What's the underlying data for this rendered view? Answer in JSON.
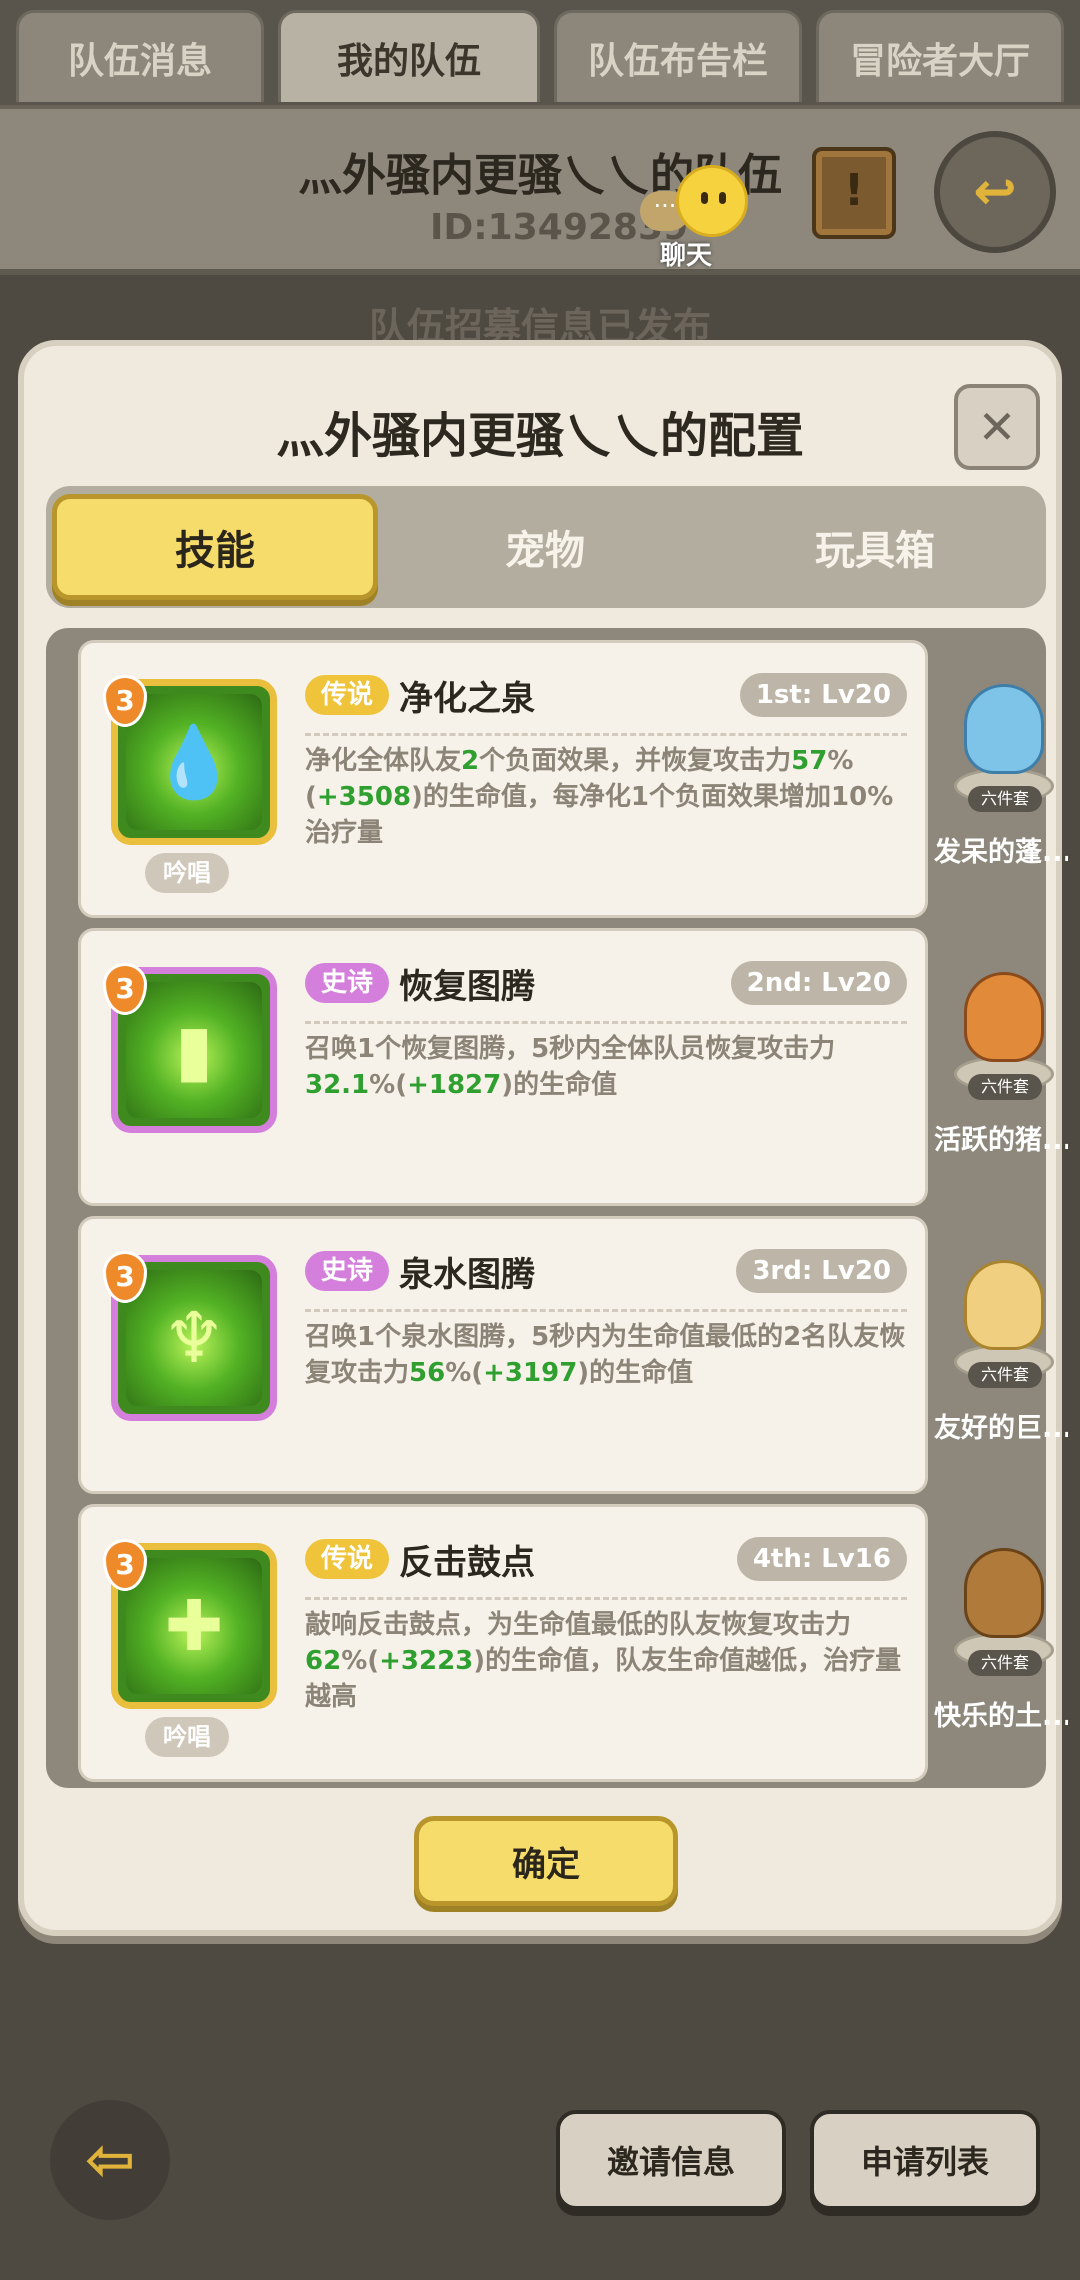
{
  "top_tabs": [
    "队伍消息",
    "我的队伍",
    "队伍布告栏",
    "冒险者大厅"
  ],
  "team": {
    "name": "灬外骚内更骚乀乀的队伍",
    "id_text": "ID:13492839",
    "chat_label": "聊天",
    "recruit_message": "队伍招募信息已发布"
  },
  "modal": {
    "title": "灬外骚内更骚乀乀的配置",
    "close_glyph": "✕",
    "tabs": [
      "技能",
      "宠物",
      "玩具箱"
    ],
    "confirm_label": "确定"
  },
  "skills": [
    {
      "level": "3",
      "rarity": "传说",
      "name": "净化之泉",
      "slot": "1st: Lv20",
      "chant": "吟唱",
      "desc_parts": [
        "净化全体队友",
        "2",
        "个负面效果，并恢复攻击力",
        "57",
        "%(",
        "+3508",
        ")的生命值，每净化1个负面效果增加10%治疗量"
      ],
      "pet_tag": "六件套",
      "pet_name": "发呆的蓬..."
    },
    {
      "level": "3",
      "rarity": "史诗",
      "name": "恢复图腾",
      "slot": "2nd: Lv20",
      "desc_parts": [
        "召唤1个恢复图腾，5秒内全体队员恢复攻击力",
        "32.1",
        "%(",
        "+1827",
        ")的生命值"
      ],
      "pet_tag": "六件套",
      "pet_name": "活跃的猪..."
    },
    {
      "level": "3",
      "rarity": "史诗",
      "name": "泉水图腾",
      "slot": "3rd: Lv20",
      "desc_parts": [
        "召唤1个泉水图腾，5秒内为生命值最低的2名队友恢复攻击力",
        "56",
        "%(",
        "+3197",
        ")的生命值"
      ],
      "pet_tag": "六件套",
      "pet_name": "友好的巨..."
    },
    {
      "level": "3",
      "rarity": "传说",
      "name": "反击鼓点",
      "slot": "4th: Lv16",
      "chant": "吟唱",
      "desc_parts": [
        "敲响反击鼓点，为生命值最低的队友恢复攻击力",
        "62",
        "%(",
        "+3223",
        ")的生命值，队友生命值越低，治疗量越高"
      ],
      "pet_tag": "六件套",
      "pet_name": "快乐的土..."
    }
  ],
  "bottom": {
    "invite_label": "邀请信息",
    "apply_label": "申请列表"
  },
  "colors": {
    "legend": "#efc33a",
    "epic": "#d57fdc",
    "highlight_green": "#2fa02f",
    "button_yellow": "#f6dc6a"
  }
}
